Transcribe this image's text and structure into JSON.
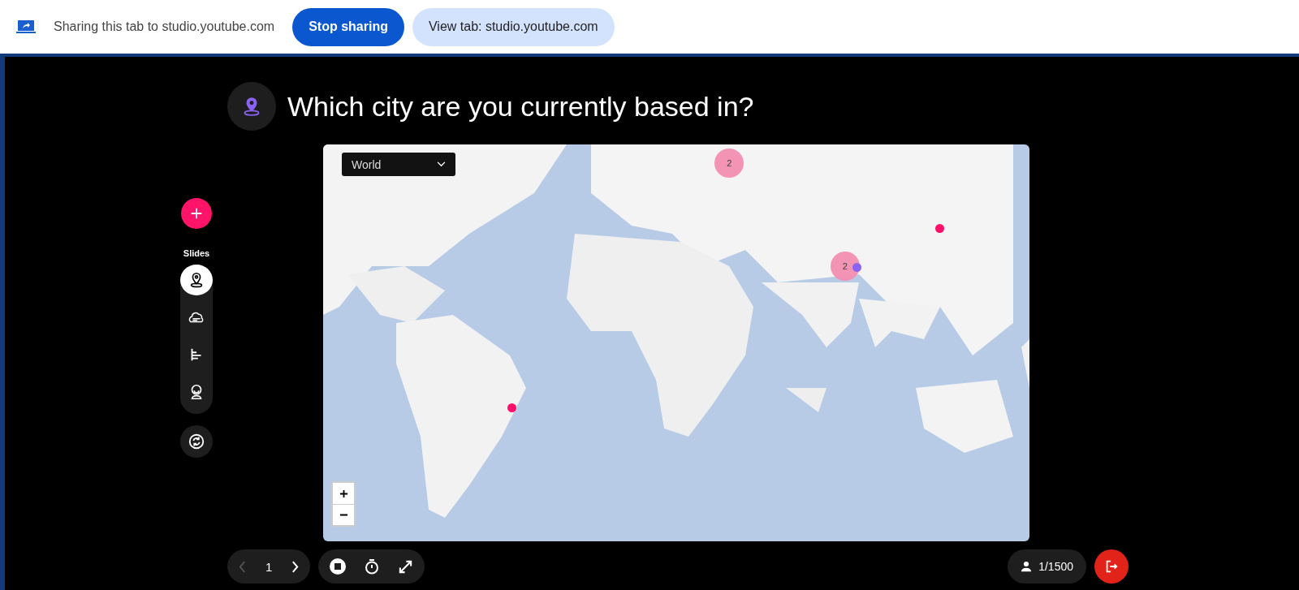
{
  "share_bar": {
    "message": "Sharing this tab to studio.youtube.com",
    "buttons": [
      {
        "label": "Stop sharing",
        "kind": "primary"
      },
      {
        "label": "View tab: studio.youtube.com",
        "kind": "secondary"
      }
    ]
  },
  "question": {
    "title": "Which city are you currently based in?"
  },
  "sidebar": {
    "slides_label": "Slides",
    "slides": [
      {
        "kind": "map",
        "selected": true
      },
      {
        "kind": "wordcloud",
        "selected": false
      },
      {
        "kind": "ranking",
        "selected": false
      },
      {
        "kind": "emoji",
        "selected": false
      }
    ]
  },
  "map": {
    "region_select": {
      "value": "World"
    },
    "markers": [
      {
        "kind": "cluster",
        "count": "2",
        "color": "#f48fb1"
      },
      {
        "kind": "point",
        "color": "#ff0f6a"
      },
      {
        "kind": "cluster",
        "count": "2",
        "color": "#f48fb1"
      },
      {
        "kind": "point",
        "color": "#8a63f5"
      },
      {
        "kind": "point",
        "color": "#ff0f6a"
      }
    ]
  },
  "navigation": {
    "page": "1"
  },
  "participants": {
    "count": "1/1500"
  }
}
